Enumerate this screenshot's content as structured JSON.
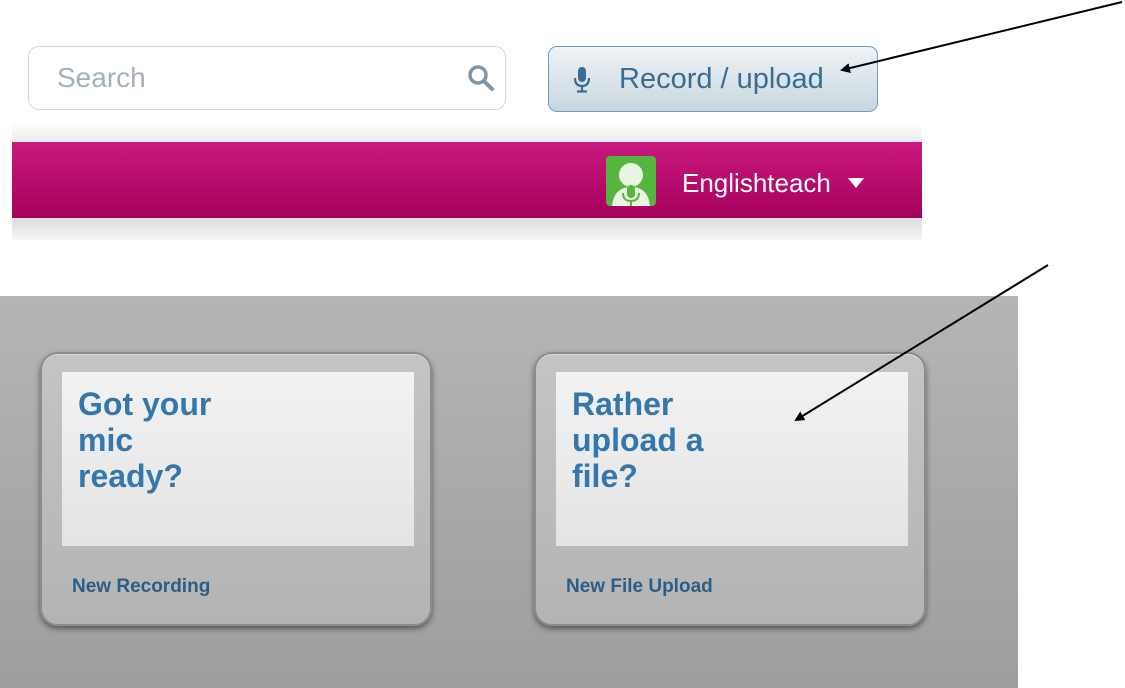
{
  "search": {
    "placeholder": "Search",
    "icon": "search-icon"
  },
  "header": {
    "record_button": {
      "label": "Record / upload",
      "icon": "microphone-icon"
    },
    "nav_bar": {
      "color": "#b8116e",
      "user": {
        "name": "Englishteach",
        "avatar_icon": "user-avatar-microphone",
        "dropdown_icon": "caret-down-icon"
      }
    }
  },
  "cards": [
    {
      "heading_lines": [
        "Got your",
        "mic",
        "ready?"
      ],
      "link_label": "New Recording"
    },
    {
      "heading_lines": [
        "Rather",
        "upload a",
        "file?"
      ],
      "link_label": "New File Upload"
    }
  ],
  "colors": {
    "accent_blue": "#3477ac",
    "nav_magenta": "#b8116e",
    "panel_grey": "#a9a9a9"
  }
}
